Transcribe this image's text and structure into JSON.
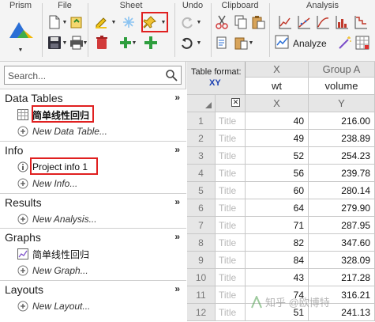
{
  "ribbon": {
    "groups": {
      "prism": "Prism",
      "file": "File",
      "sheet": "Sheet",
      "undo": "Undo",
      "clipboard": "Clipboard",
      "analysis": "Analysis"
    },
    "analyze_label": "Analyze",
    "highlight_color": "#e02020"
  },
  "navigator": {
    "search_placeholder": "Search...",
    "sections": {
      "data_tables": {
        "title": "Data Tables",
        "items": [
          "简单线性回归"
        ],
        "new_label": "New Data Table..."
      },
      "info": {
        "title": "Info",
        "items": [
          "Project info 1"
        ],
        "new_label": "New Info..."
      },
      "results": {
        "title": "Results",
        "new_label": "New Analysis..."
      },
      "graphs": {
        "title": "Graphs",
        "items": [
          "简单线性回归"
        ],
        "new_label": "New Graph..."
      },
      "layouts": {
        "title": "Layouts",
        "new_label": "New Layout..."
      }
    },
    "collapse_glyph": "»"
  },
  "sheet": {
    "table_format_label": "Table format:",
    "table_format_value": "XY",
    "columns": [
      {
        "name": "X",
        "title": "wt",
        "sub": "X"
      },
      {
        "name": "Group A",
        "title": "volume",
        "sub": "Y"
      }
    ],
    "title_placeholder": "Title",
    "rows": [
      {
        "n": "1",
        "x": "40",
        "y": "216.00"
      },
      {
        "n": "2",
        "x": "49",
        "y": "238.89"
      },
      {
        "n": "3",
        "x": "52",
        "y": "254.23"
      },
      {
        "n": "4",
        "x": "56",
        "y": "239.78"
      },
      {
        "n": "5",
        "x": "60",
        "y": "280.14"
      },
      {
        "n": "6",
        "x": "64",
        "y": "279.90"
      },
      {
        "n": "7",
        "x": "71",
        "y": "287.95"
      },
      {
        "n": "8",
        "x": "82",
        "y": "347.60"
      },
      {
        "n": "9",
        "x": "84",
        "y": "328.09"
      },
      {
        "n": "10",
        "x": "43",
        "y": "217.28"
      },
      {
        "n": "11",
        "x": "74",
        "y": "316.21"
      },
      {
        "n": "12",
        "x": "51",
        "y": "241.13"
      }
    ]
  },
  "watermark": "知乎 @欧博特"
}
